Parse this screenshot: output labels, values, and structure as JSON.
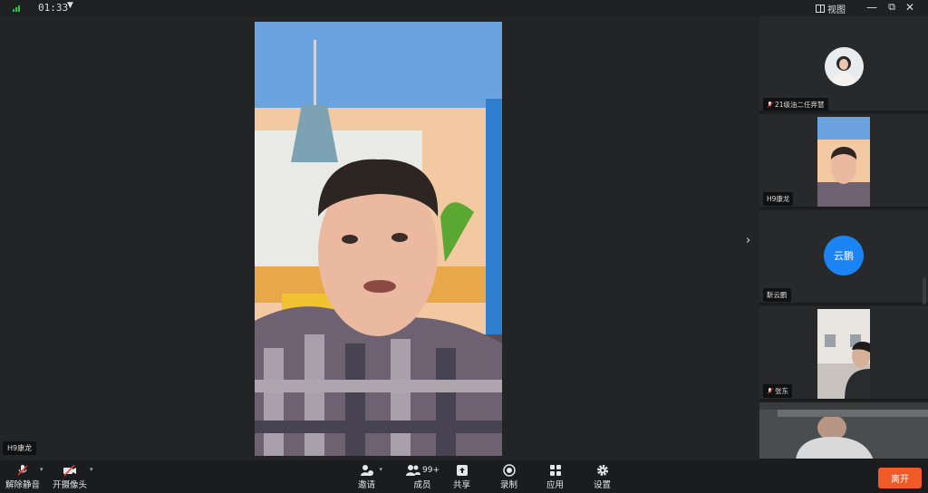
{
  "topbar": {
    "timer": "01:33",
    "view_label": "视图"
  },
  "main_video": {
    "participant": "H9康龙"
  },
  "sidebar": {
    "tiles": [
      {
        "name": "21级油二任奔慧",
        "muted": true
      },
      {
        "name": "H9康龙",
        "muted": false
      },
      {
        "name": "靳云鹏",
        "muted": false,
        "avatar_text": "云鹏"
      },
      {
        "name": "张东",
        "muted": true
      },
      {
        "name": "",
        "muted": false
      }
    ]
  },
  "toolbar": {
    "unmute": "解除静音",
    "camera": "开摄像头",
    "invite": "邀请",
    "members": "成员",
    "members_count": "99+",
    "share": "共享",
    "record": "录制",
    "apps": "应用",
    "settings": "设置",
    "leave": "离开"
  },
  "colors": {
    "leave_button": "#ef5a28",
    "avatar_blue": "#1a84f4",
    "signal_green": "#2fbf4f"
  }
}
